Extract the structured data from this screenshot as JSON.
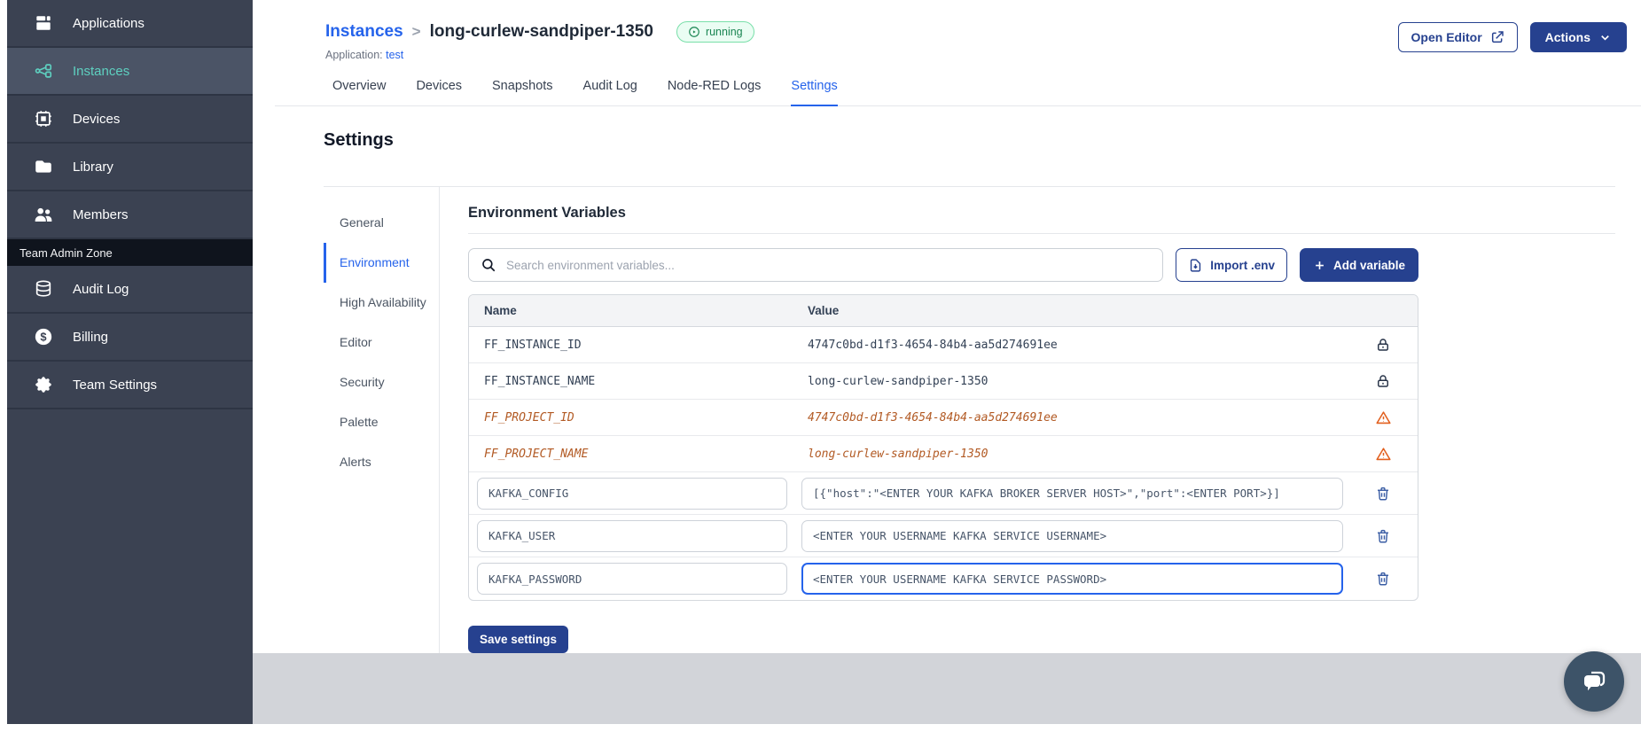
{
  "colors": {
    "accent_blue": "#2563eb",
    "navy_button": "#26418f",
    "sidebar_bg": "#3b4252",
    "teal_active": "#5ed0c0",
    "status_green": "#1b8653",
    "deprecated_orange": "#b25a24"
  },
  "sidebar": {
    "items": [
      {
        "label": "Applications",
        "icon": "applications-icon"
      },
      {
        "label": "Instances",
        "icon": "instances-icon",
        "active": true
      },
      {
        "label": "Devices",
        "icon": "devices-icon"
      },
      {
        "label": "Library",
        "icon": "library-icon"
      },
      {
        "label": "Members",
        "icon": "members-icon"
      }
    ],
    "section_label": "Team Admin Zone",
    "admin_items": [
      {
        "label": "Audit Log",
        "icon": "audit-log-icon"
      },
      {
        "label": "Billing",
        "icon": "billing-icon"
      },
      {
        "label": "Team Settings",
        "icon": "team-settings-icon"
      }
    ]
  },
  "header": {
    "breadcrumb": "Instances",
    "breadcrumb_separator": ">",
    "instance_name": "long-curlew-sandpiper-1350",
    "status": "running",
    "application_label": "Application:",
    "application_name": "test",
    "open_editor": "Open Editor",
    "actions": "Actions"
  },
  "tabs": {
    "items": [
      "Overview",
      "Devices",
      "Snapshots",
      "Audit Log",
      "Node-RED Logs",
      "Settings"
    ],
    "active": "Settings"
  },
  "settings": {
    "title": "Settings",
    "nav": [
      "General",
      "Environment",
      "High Availability",
      "Editor",
      "Security",
      "Palette",
      "Alerts"
    ],
    "nav_active": "Environment",
    "section_title": "Environment Variables",
    "search_placeholder": "Search environment variables...",
    "import_button": "Import .env",
    "add_button": "Add variable",
    "save_button": "Save settings",
    "table": {
      "columns": [
        "Name",
        "Value"
      ],
      "rows": [
        {
          "name": "FF_INSTANCE_ID",
          "value": "4747c0bd-d1f3-4654-84b4-aa5d274691ee",
          "state": "locked"
        },
        {
          "name": "FF_INSTANCE_NAME",
          "value": "long-curlew-sandpiper-1350",
          "state": "locked"
        },
        {
          "name": "FF_PROJECT_ID",
          "value": "4747c0bd-d1f3-4654-84b4-aa5d274691ee",
          "state": "deprecated"
        },
        {
          "name": "FF_PROJECT_NAME",
          "value": "long-curlew-sandpiper-1350",
          "state": "deprecated"
        },
        {
          "name": "KAFKA_CONFIG",
          "value": "[{\"host\":\"<ENTER YOUR KAFKA BROKER SERVER HOST>\",\"port\":<ENTER PORT>}]",
          "state": "editable"
        },
        {
          "name": "KAFKA_USER",
          "value": "<ENTER YOUR USERNAME KAFKA SERVICE USERNAME>",
          "state": "editable"
        },
        {
          "name": "KAFKA_PASSWORD",
          "value": "<ENTER YOUR USERNAME KAFKA SERVICE PASSWORD>",
          "state": "editable",
          "focused": true
        }
      ]
    }
  }
}
